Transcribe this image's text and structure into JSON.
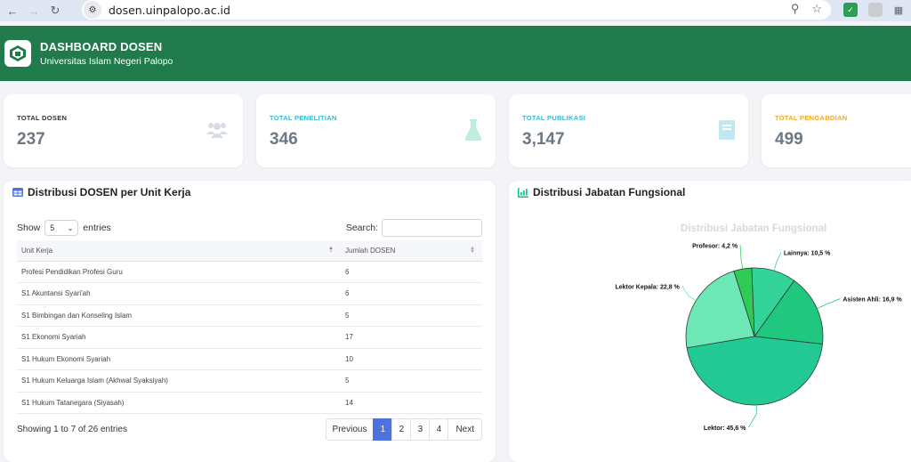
{
  "browser": {
    "url": "dosen.uinpalopo.ac.id"
  },
  "header": {
    "title": "DASHBOARD DOSEN",
    "subtitle": "Universitas Islam Negeri Palopo"
  },
  "stats": [
    {
      "label": "TOTAL DOSEN",
      "value": "237",
      "color": "#333333",
      "icon": "users-icon"
    },
    {
      "label": "TOTAL PENELITIAN",
      "value": "346",
      "color": "#36b9cc",
      "icon": "flask-icon"
    },
    {
      "label": "TOTAL PUBLIKASI",
      "value": "3,147",
      "color": "#36b9cc",
      "icon": "book-icon"
    },
    {
      "label": "TOTAL PENGABDIAN",
      "value": "499",
      "color": "#f6a623",
      "icon": "hands-icon"
    }
  ],
  "table_panel": {
    "title": "Distribusi DOSEN per Unit Kerja",
    "show_label": "Show",
    "show_value": "5",
    "entries_label": "entries",
    "search_label": "Search:",
    "columns": [
      "Unit Kerja",
      "Jumlah DOSEN"
    ],
    "rows": [
      [
        "Profesi Pendidikan Profesi Guru",
        "6"
      ],
      [
        "S1 Akuntansi Syari'ah",
        "6"
      ],
      [
        "S1 Bimbingan dan Konseling Islam",
        "5"
      ],
      [
        "S1 Ekonomi Syariah",
        "17"
      ],
      [
        "S1 Hukum Ekonomi Syariah",
        "10"
      ],
      [
        "S1 Hukum Keluarga Islam (Akhwal Syaksiyah)",
        "5"
      ],
      [
        "S1 Hukum Tatanegara (Siyasah)",
        "14"
      ]
    ],
    "info": "Showing 1 to 7 of 26 entries",
    "pagination": [
      "Previous",
      "1",
      "2",
      "3",
      "4",
      "Next"
    ],
    "active_page": "1"
  },
  "chart_panel": {
    "title": "Distribusi Jabatan Fungsional"
  },
  "chart_data": {
    "type": "pie",
    "title": "Distribusi Jabatan Fungsional",
    "slices": [
      {
        "label": "Lainnya: 10,5 %",
        "value": 10.5,
        "color": "#34d399"
      },
      {
        "label": "Asisten Ahli: 16,9 %",
        "value": 16.9,
        "color": "#20c77e"
      },
      {
        "label": "Lektor: 45,6 %",
        "value": 45.6,
        "color": "#22c995"
      },
      {
        "label": "Lektor Kepala: 22,8 %",
        "value": 22.8,
        "color": "#6ee7b7"
      },
      {
        "label": "Profesor: 4,2 %",
        "value": 4.2,
        "color": "#2ecc55"
      }
    ]
  }
}
